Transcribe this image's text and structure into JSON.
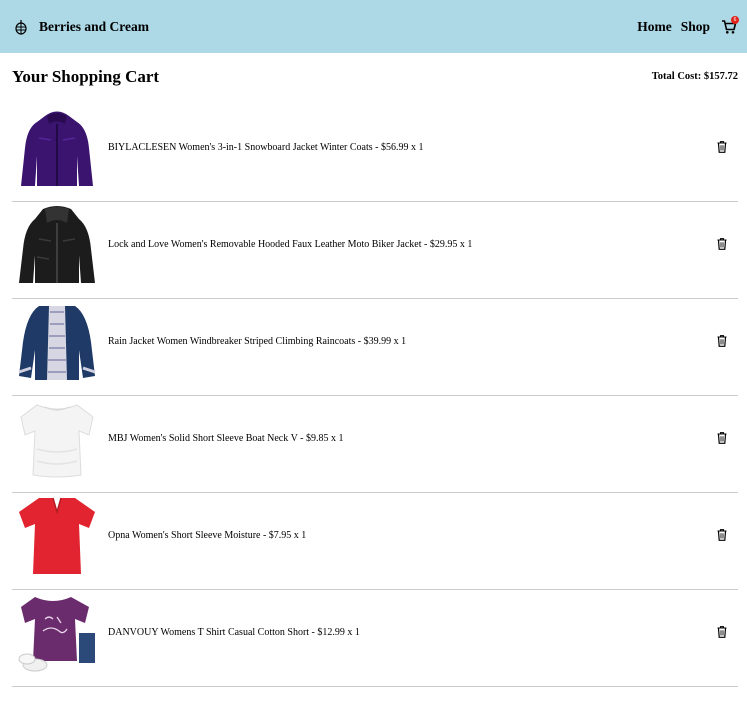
{
  "navbar": {
    "brand_name": "Berries and Cream",
    "brand_icon": "berry-logo-icon",
    "links": {
      "home": "Home",
      "shop": "Shop"
    },
    "cart_icon": "shopping-cart-icon",
    "cart_badge": "6",
    "background": "#add8e6"
  },
  "cart": {
    "title": "Your Shopping Cart",
    "total_label": "Total Cost: $157.72",
    "delete_icon": "trash-icon",
    "items": [
      {
        "text": "BIYLACLESEN Women's 3-in-1 Snowboard Jacket Winter Coats - $56.99 x 1",
        "image": "purple-jacket"
      },
      {
        "text": "Lock and Love Women's Removable Hooded Faux Leather Moto Biker Jacket - $29.95 x 1",
        "image": "black-leather-jacket"
      },
      {
        "text": "Rain Jacket Women Windbreaker Striped Climbing Raincoats - $39.99 x 1",
        "image": "navy-striped-raincoat"
      },
      {
        "text": "MBJ Women's Solid Short Sleeve Boat Neck V - $9.85 x 1",
        "image": "white-tshirt"
      },
      {
        "text": "Opna Women's Short Sleeve Moisture - $7.95 x 1",
        "image": "red-tshirt"
      },
      {
        "text": "DANVOUY Womens T Shirt Casual Cotton Short - $12.99 x 1",
        "image": "purple-graphic-tshirt"
      }
    ]
  }
}
